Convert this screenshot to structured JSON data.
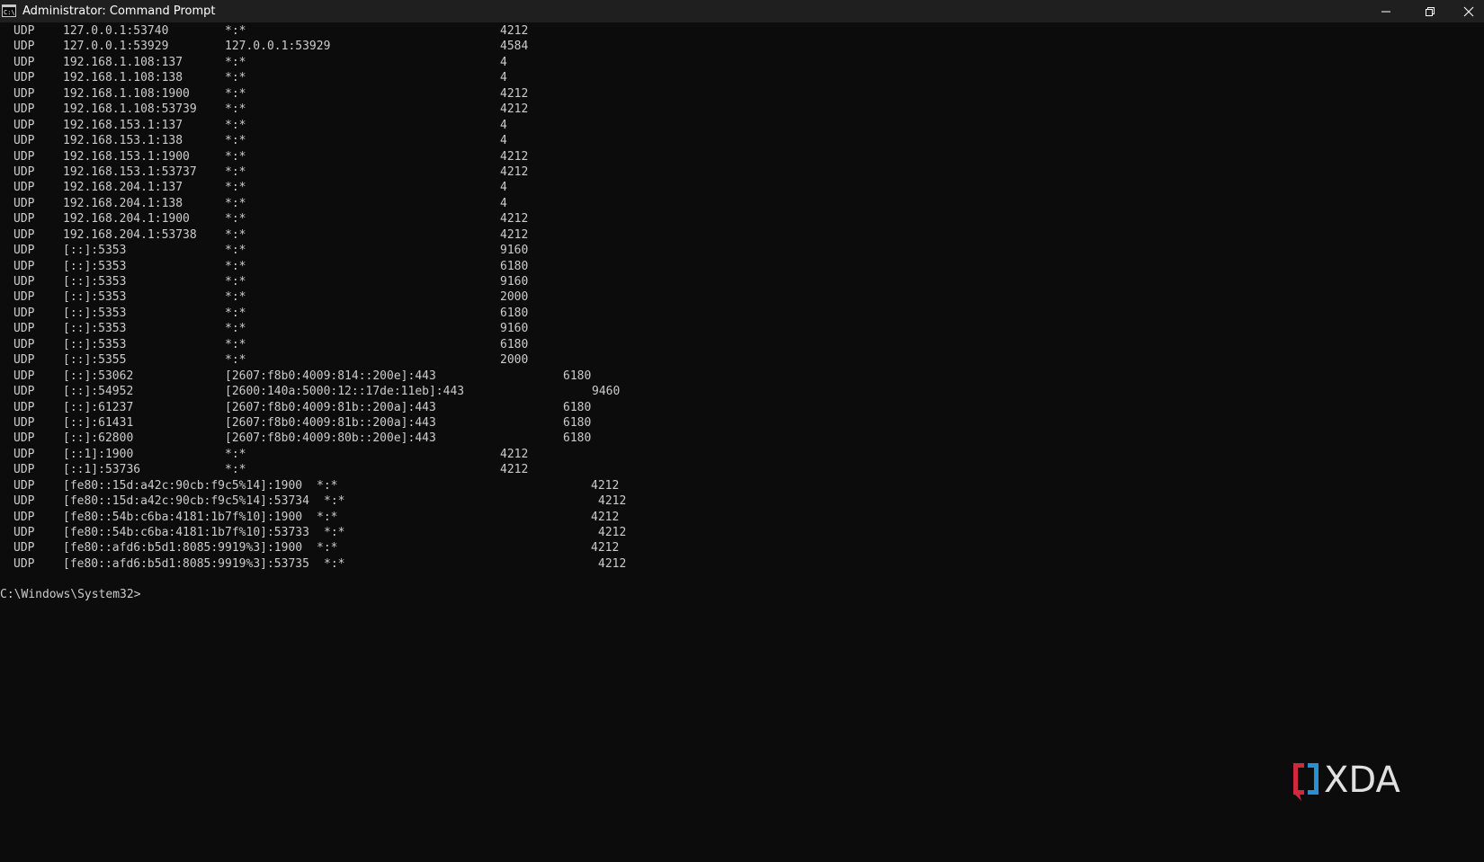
{
  "window": {
    "title": "Administrator: Command Prompt",
    "app_icon": "command-prompt-icon",
    "controls": [
      "minimize-icon",
      "restore-icon",
      "close-icon"
    ]
  },
  "console": {
    "rows": [
      {
        "proto": "UDP",
        "local": "127.0.0.1:53740",
        "foreign": "*:*",
        "pid": "4212",
        "f": 250,
        "p": 556
      },
      {
        "proto": "UDP",
        "local": "127.0.0.1:53929",
        "foreign": "127.0.0.1:53929",
        "pid": "4584",
        "f": 250,
        "p": 556
      },
      {
        "proto": "UDP",
        "local": "192.168.1.108:137",
        "foreign": "*:*",
        "pid": "4",
        "f": 250,
        "p": 556
      },
      {
        "proto": "UDP",
        "local": "192.168.1.108:138",
        "foreign": "*:*",
        "pid": "4",
        "f": 250,
        "p": 556
      },
      {
        "proto": "UDP",
        "local": "192.168.1.108:1900",
        "foreign": "*:*",
        "pid": "4212",
        "f": 250,
        "p": 556
      },
      {
        "proto": "UDP",
        "local": "192.168.1.108:53739",
        "foreign": "*:*",
        "pid": "4212",
        "f": 250,
        "p": 556
      },
      {
        "proto": "UDP",
        "local": "192.168.153.1:137",
        "foreign": "*:*",
        "pid": "4",
        "f": 250,
        "p": 556
      },
      {
        "proto": "UDP",
        "local": "192.168.153.1:138",
        "foreign": "*:*",
        "pid": "4",
        "f": 250,
        "p": 556
      },
      {
        "proto": "UDP",
        "local": "192.168.153.1:1900",
        "foreign": "*:*",
        "pid": "4212",
        "f": 250,
        "p": 556
      },
      {
        "proto": "UDP",
        "local": "192.168.153.1:53737",
        "foreign": "*:*",
        "pid": "4212",
        "f": 250,
        "p": 556
      },
      {
        "proto": "UDP",
        "local": "192.168.204.1:137",
        "foreign": "*:*",
        "pid": "4",
        "f": 250,
        "p": 556
      },
      {
        "proto": "UDP",
        "local": "192.168.204.1:138",
        "foreign": "*:*",
        "pid": "4",
        "f": 250,
        "p": 556
      },
      {
        "proto": "UDP",
        "local": "192.168.204.1:1900",
        "foreign": "*:*",
        "pid": "4212",
        "f": 250,
        "p": 556
      },
      {
        "proto": "UDP",
        "local": "192.168.204.1:53738",
        "foreign": "*:*",
        "pid": "4212",
        "f": 250,
        "p": 556
      },
      {
        "proto": "UDP",
        "local": "[::]:5353",
        "foreign": "*:*",
        "pid": "9160",
        "f": 250,
        "p": 556
      },
      {
        "proto": "UDP",
        "local": "[::]:5353",
        "foreign": "*:*",
        "pid": "6180",
        "f": 250,
        "p": 556
      },
      {
        "proto": "UDP",
        "local": "[::]:5353",
        "foreign": "*:*",
        "pid": "9160",
        "f": 250,
        "p": 556
      },
      {
        "proto": "UDP",
        "local": "[::]:5353",
        "foreign": "*:*",
        "pid": "2000",
        "f": 250,
        "p": 556
      },
      {
        "proto": "UDP",
        "local": "[::]:5353",
        "foreign": "*:*",
        "pid": "6180",
        "f": 250,
        "p": 556
      },
      {
        "proto": "UDP",
        "local": "[::]:5353",
        "foreign": "*:*",
        "pid": "9160",
        "f": 250,
        "p": 556
      },
      {
        "proto": "UDP",
        "local": "[::]:5353",
        "foreign": "*:*",
        "pid": "6180",
        "f": 250,
        "p": 556
      },
      {
        "proto": "UDP",
        "local": "[::]:5355",
        "foreign": "*:*",
        "pid": "2000",
        "f": 250,
        "p": 556
      },
      {
        "proto": "UDP",
        "local": "[::]:53062",
        "foreign": "[2607:f8b0:4009:814::200e]:443",
        "pid": "6180",
        "f": 250,
        "p": 626
      },
      {
        "proto": "UDP",
        "local": "[::]:54952",
        "foreign": "[2600:140a:5000:12::17de:11eb]:443",
        "pid": "9460",
        "f": 250,
        "p": 658
      },
      {
        "proto": "UDP",
        "local": "[::]:61237",
        "foreign": "[2607:f8b0:4009:81b::200a]:443",
        "pid": "6180",
        "f": 250,
        "p": 626
      },
      {
        "proto": "UDP",
        "local": "[::]:61431",
        "foreign": "[2607:f8b0:4009:81b::200a]:443",
        "pid": "6180",
        "f": 250,
        "p": 626
      },
      {
        "proto": "UDP",
        "local": "[::]:62800",
        "foreign": "[2607:f8b0:4009:80b::200e]:443",
        "pid": "6180",
        "f": 250,
        "p": 626
      },
      {
        "proto": "UDP",
        "local": "[::1]:1900",
        "foreign": "*:*",
        "pid": "4212",
        "f": 250,
        "p": 556
      },
      {
        "proto": "UDP",
        "local": "[::1]:53736",
        "foreign": "*:*",
        "pid": "4212",
        "f": 250,
        "p": 556
      },
      {
        "proto": "UDP",
        "local": "[fe80::15d:a42c:90cb:f9c5%14]:1900",
        "foreign": "*:*",
        "pid": "4212",
        "f": 352,
        "p": 657
      },
      {
        "proto": "UDP",
        "local": "[fe80::15d:a42c:90cb:f9c5%14]:53734",
        "foreign": "*:*",
        "pid": "4212",
        "f": 360,
        "p": 665
      },
      {
        "proto": "UDP",
        "local": "[fe80::54b:c6ba:4181:1b7f%10]:1900",
        "foreign": "*:*",
        "pid": "4212",
        "f": 352,
        "p": 657
      },
      {
        "proto": "UDP",
        "local": "[fe80::54b:c6ba:4181:1b7f%10]:53733",
        "foreign": "*:*",
        "pid": "4212",
        "f": 360,
        "p": 665
      },
      {
        "proto": "UDP",
        "local": "[fe80::afd6:b5d1:8085:9919%3]:1900",
        "foreign": "*:*",
        "pid": "4212",
        "f": 352,
        "p": 657
      },
      {
        "proto": "UDP",
        "local": "[fe80::afd6:b5d1:8085:9919%3]:53735",
        "foreign": "*:*",
        "pid": "4212",
        "f": 360,
        "p": 665
      }
    ],
    "prompt": "C:\\Windows\\System32>"
  },
  "watermark": {
    "text": "XDA",
    "logo": "xda-logo",
    "colors": {
      "red": "#d2283c",
      "blue": "#2a8fd0",
      "gray": "#e0e0e0"
    }
  }
}
